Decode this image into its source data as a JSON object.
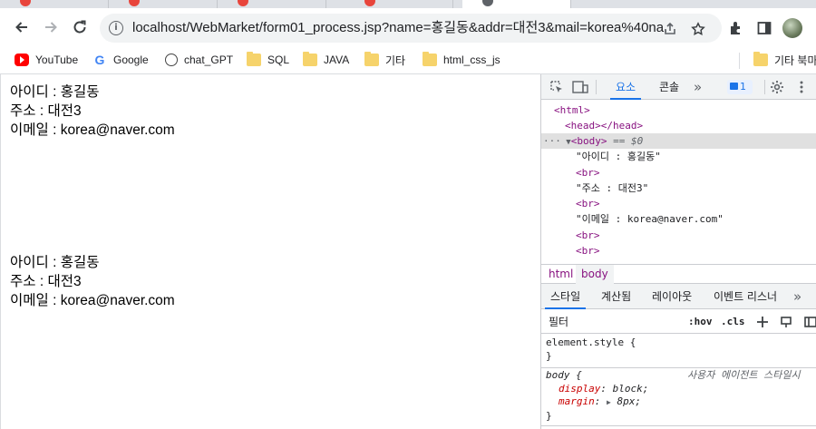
{
  "browser": {
    "url": "localhost/WebMarket/form01_process.jsp?name=홍길동&addr=대전3&mail=korea%40na..."
  },
  "bookmarks": [
    {
      "label": "YouTube",
      "icon": "youtube-icon"
    },
    {
      "label": "Google",
      "icon": "google-icon"
    },
    {
      "label": "chat_GPT",
      "icon": "chatgpt-icon"
    },
    {
      "label": "SQL",
      "icon": "folder-icon"
    },
    {
      "label": "JAVA",
      "icon": "folder-icon"
    },
    {
      "label": "기타",
      "icon": "folder-icon"
    },
    {
      "label": "html_css_js",
      "icon": "folder-icon"
    }
  ],
  "other_bookmarks": {
    "label": "기타 북마",
    "icon": "folder-icon"
  },
  "page": {
    "blocks": [
      {
        "lines": [
          "아이디 : 홍길동",
          "주소 : 대전3",
          "이메일 : korea@naver.com"
        ]
      },
      {
        "lines": [
          "아이디 : 홍길동",
          "주소 : 대전3",
          "이메일 : korea@naver.com"
        ]
      }
    ]
  },
  "devtools": {
    "tabs": {
      "elements": "요소",
      "console": "콘솔",
      "more": "»"
    },
    "issues_count": "1",
    "dom": {
      "html": "<html>",
      "head": "<head></head>",
      "body_dots": "···",
      "body": "<body>",
      "body_eq": "== $0",
      "text1": "\"아이디 : 홍길동\"",
      "br": "<br>",
      "text2": "\"주소 : 대전3\"",
      "text3": "\"이메일 : korea@naver.com\""
    },
    "breadcrumbs": [
      "html",
      "body"
    ],
    "style_tabs": [
      "스타일",
      "계산됨",
      "레이아웃",
      "이벤트 리스너",
      "»"
    ],
    "filter_placeholder": "필터",
    "hov": ":hov",
    "cls": ".cls",
    "rules": {
      "element_style": "element.style {",
      "close": "}",
      "body_selector": "body {",
      "ua_label": "사용자 에이전트 스타일시",
      "display_prop": "display",
      "display_val": "block;",
      "margin_prop": "margin",
      "margin_val": "8px;"
    }
  }
}
